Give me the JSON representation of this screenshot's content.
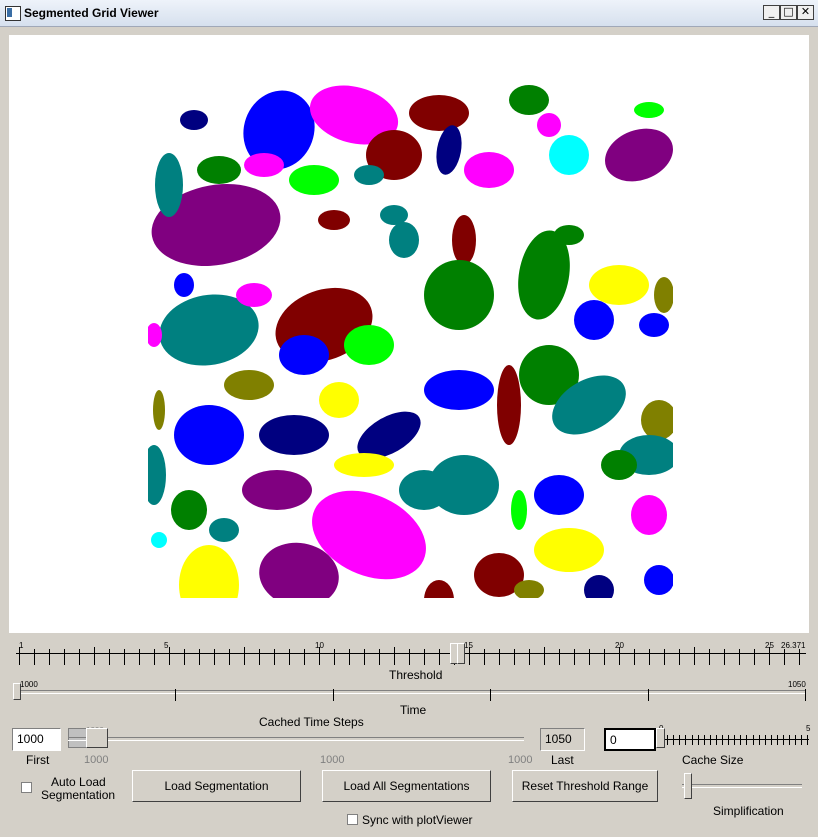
{
  "window": {
    "title": "Segmented Grid Viewer",
    "buttons": {
      "minimize": "_",
      "maximize": "□",
      "close": "✕"
    }
  },
  "threshold_slider": {
    "label": "Threshold",
    "tick_labels": [
      "1",
      "5",
      "10",
      "15",
      "20",
      "25",
      "26.371"
    ],
    "value": 15
  },
  "time_slider": {
    "label": "Time",
    "min_label": "1000",
    "max_label": "1050"
  },
  "cached_time_steps": {
    "label": "Cached Time Steps",
    "first_value": "1000",
    "first_label": "First",
    "last_value": "1050",
    "last_label": "Last",
    "range_low": "1000",
    "range_mid": "1000",
    "range_high": "1000",
    "thumb_label": "1000"
  },
  "cache_size": {
    "value": "0",
    "label": "Cache Size",
    "tick_min": "0",
    "tick_max": "5"
  },
  "simplification": {
    "label": "Simplification"
  },
  "auto_load": {
    "label_line1": "Auto Load",
    "label_line2": "Segmentation",
    "checked": false
  },
  "buttons": {
    "load_segmentation": "Load Segmentation",
    "load_all_segmentations": "Load All Segmentations",
    "reset_threshold_range": "Reset Threshold Range"
  },
  "sync": {
    "label": "Sync with plotViewer",
    "checked": false
  },
  "segment_colors": [
    "#800080",
    "#0000ff",
    "#ff00ff",
    "#800000",
    "#008000",
    "#008080",
    "#000080",
    "#ffff00",
    "#00ff00",
    "#00ffff",
    "#808000"
  ]
}
